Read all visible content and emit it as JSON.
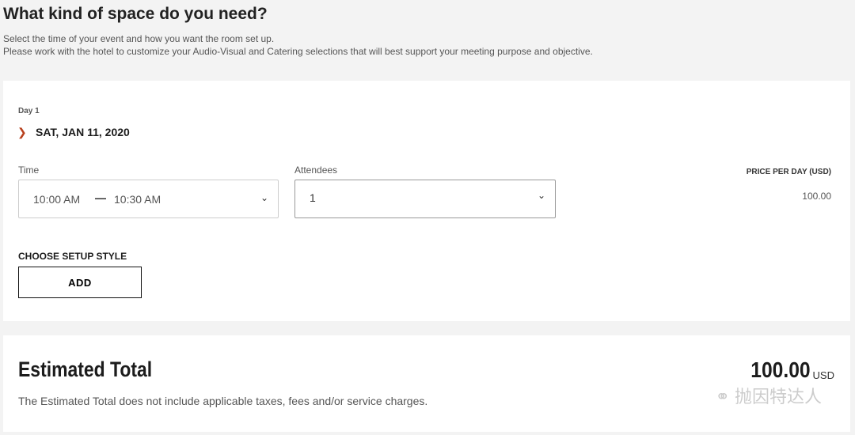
{
  "header": {
    "title": "What kind of space do you need?",
    "line1": "Select the time of your event and how you want the room set up.",
    "line2": "Please work with the hotel to customize your Audio-Visual and Catering selections that will best support your meeting purpose and objective."
  },
  "day": {
    "label": "Day 1",
    "date": "SAT, JAN 11, 2020",
    "time_label": "Time",
    "start": "10:00 AM",
    "end": "10:30 AM",
    "attendees_label": "Attendees",
    "attendees": "1",
    "price_label": "PRICE PER DAY (USD)",
    "price": "100.00",
    "setup_label": "CHOOSE SETUP STYLE",
    "add_label": "ADD"
  },
  "total": {
    "title": "Estimated Total",
    "note": "The Estimated Total does not include applicable taxes, fees and/or service charges.",
    "amount": "100.00",
    "currency": "USD",
    "watermark": "抛因特达人"
  },
  "colors": {
    "accent": "#b8401d"
  }
}
